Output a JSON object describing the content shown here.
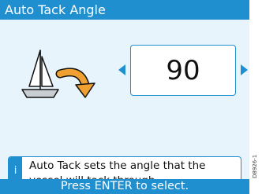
{
  "title": "Auto Tack Angle",
  "angle_value": "90",
  "info": {
    "icon_glyph": "i",
    "text": "Auto Tack sets the angle that the vessel will tack through."
  },
  "footer": "Press ENTER to select.",
  "doc_code": "D8926-1",
  "icons": {
    "boat": "sailboat-icon",
    "tack": "curved-arrow-icon",
    "decrease": "triangle-left-icon",
    "increase": "triangle-right-icon"
  },
  "colors": {
    "accent": "#1f8fd0",
    "background": "#e7f4fb",
    "tack_arrow": "#f0a030"
  }
}
